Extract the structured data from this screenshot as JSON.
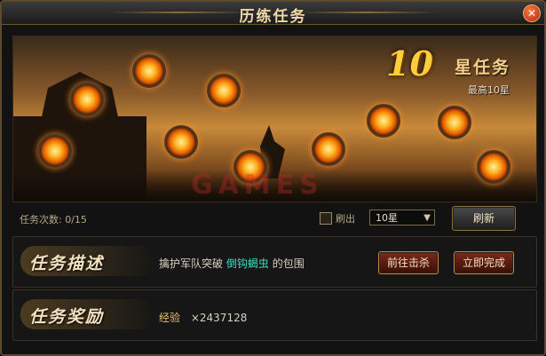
{
  "window": {
    "title": "历练任务",
    "close_glyph": "✕"
  },
  "banner": {
    "star_number": "10",
    "star_label": "星任务",
    "max_star": "最高10星",
    "watermark": "GAMES"
  },
  "controls": {
    "count_label": "任务次数:",
    "count_value": "0/15",
    "refresh_checkbox_label": "刷出",
    "star_select_value": "10星",
    "refresh_button": "刷新"
  },
  "description": {
    "title": "任务描述",
    "text_before": "擒护军队突破",
    "highlight": "倒钩蝎虫",
    "text_after": "的包围",
    "goto_button": "前往击杀",
    "finish_button": "立即完成"
  },
  "reward": {
    "title": "任务奖励",
    "item": "经验",
    "amount": "×2437128"
  },
  "colors": {
    "accent": "#f0d8a6",
    "highlight": "#3ae0c0",
    "reward": "#e8c070"
  }
}
